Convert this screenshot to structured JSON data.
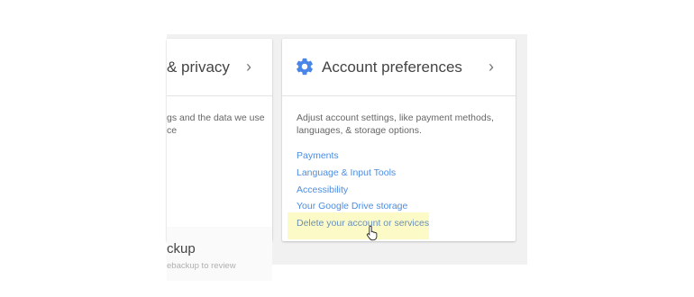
{
  "left_card": {
    "title_fragment": "& privacy",
    "chevron": "›",
    "desc_lines": [
      "gs and the data we use",
      "ce"
    ]
  },
  "left_bottom": {
    "title_fragment": "ckup",
    "desc_fragment": "ebackup to review"
  },
  "account_card": {
    "icon": "gear-icon",
    "title": "Account preferences",
    "chevron": "›",
    "description_lines": [
      "Adjust account settings, like payment methods,",
      "languages, & storage options."
    ],
    "links": [
      "Payments",
      "Language & Input Tools",
      "Accessibility",
      "Your Google Drive storage",
      "Delete your account or services"
    ]
  },
  "colors": {
    "accent": "#4d8de0",
    "highlight": "#fcfbc7"
  }
}
